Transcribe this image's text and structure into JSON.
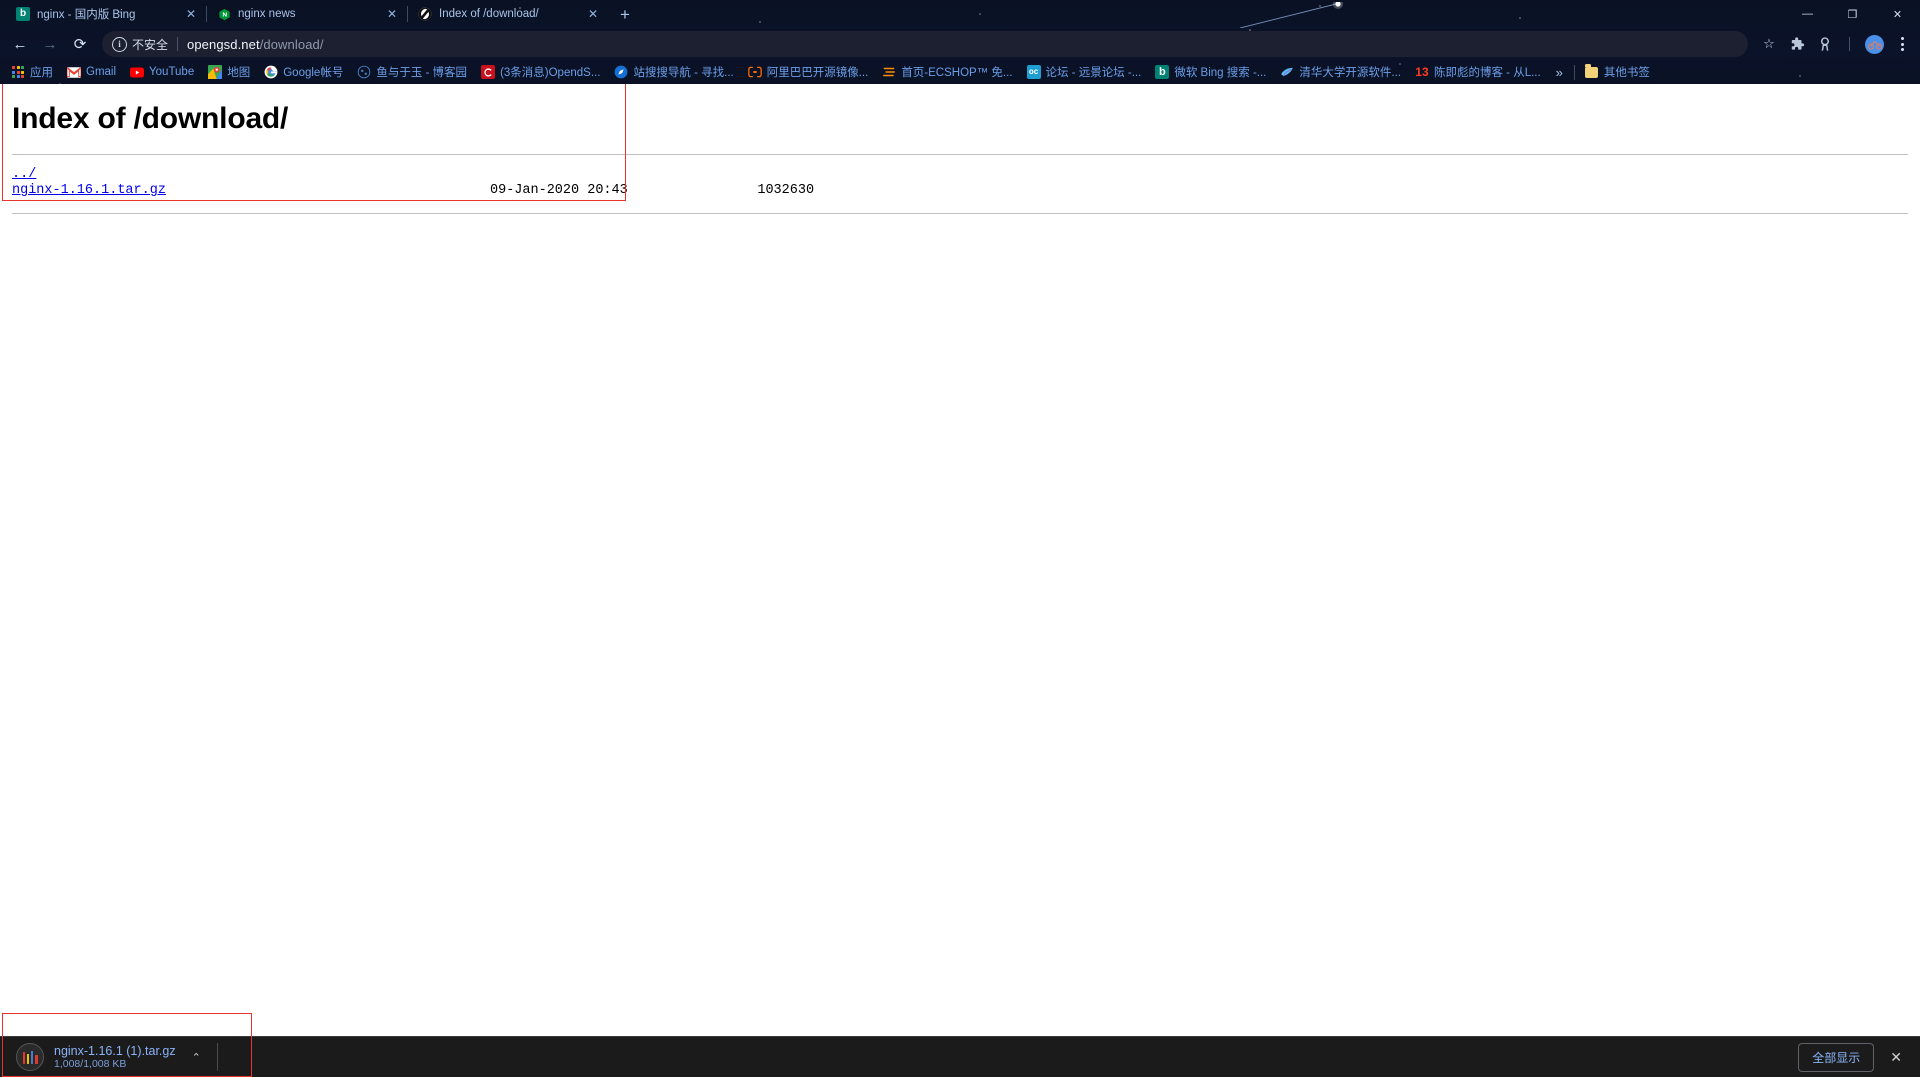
{
  "window": {
    "controls": {
      "minimize": "—",
      "maximize": "❐",
      "close": "✕"
    }
  },
  "tabs": [
    {
      "title": "nginx - 国内版 Bing",
      "favicon": "bing-icon",
      "close": "✕",
      "active": false
    },
    {
      "title": "nginx news",
      "favicon": "nginx-icon",
      "close": "✕",
      "active": false
    },
    {
      "title": "Index of /download/",
      "favicon": "nginx-globe-icon",
      "close": "✕",
      "active": true
    }
  ],
  "newtab_label": "+",
  "toolbar": {
    "back": "←",
    "forward": "→",
    "reload": "⟳",
    "security_label": "不安全",
    "security_icon": "i",
    "url_host": "opengsd.net",
    "url_path": "/download/",
    "bookmark_star": "☆",
    "extension_1": "puzzle-icon",
    "extension_2": "extension-icon",
    "profile": "avatar-bicycle",
    "menu": "kebab-menu"
  },
  "bookmarks": {
    "items": [
      {
        "label": "应用",
        "icon": "apps-grid-icon"
      },
      {
        "label": "Gmail",
        "icon": "gmail-icon"
      },
      {
        "label": "YouTube",
        "icon": "youtube-icon"
      },
      {
        "label": "地图",
        "icon": "maps-icon"
      },
      {
        "label": "Google帐号",
        "icon": "google-icon"
      },
      {
        "label": "鱼与于玉 - 博客园",
        "icon": "cnblogs-icon"
      },
      {
        "label": "(3条消息)OpendS...",
        "icon": "csdn-icon"
      },
      {
        "label": "站搜搜导航 - 寻找...",
        "icon": "compass-icon"
      },
      {
        "label": "阿里巴巴开源镜像...",
        "icon": "alibaba-icon"
      },
      {
        "label": "首页-ECSHOP™ 免...",
        "icon": "ecshop-icon"
      },
      {
        "label": "论坛 - 远景论坛 -...",
        "icon": "pcbeta-icon"
      },
      {
        "label": "微软 Bing 搜索 -...",
        "icon": "bing-icon"
      },
      {
        "label": "清华大学开源软件...",
        "icon": "tuna-icon"
      },
      {
        "label": "陈即彪的博客 - 从L...",
        "icon": "blog-13-icon"
      }
    ],
    "overflow_label": "»",
    "other_bookmarks_label": "其他书签",
    "other_bookmarks_icon": "folder-icon"
  },
  "page": {
    "heading": "Index of /download/",
    "listing": {
      "parent_link": "../",
      "rows": [
        {
          "name": "nginx-1.16.1.tar.gz",
          "date": "09-Jan-2020 20:43",
          "size": "1032630"
        }
      ]
    }
  },
  "download_shelf": {
    "file_name": "nginx-1.16.1 (1).tar.gz",
    "progress_text": "1,008/1,008 KB",
    "caret": "⌃",
    "show_all_label": "全部显示",
    "close_label": "✕"
  },
  "colors": {
    "link": "#0000ee",
    "visited": "#551a8b",
    "bookmark_text": "#6b9fe8",
    "accent_blue": "#8ab4f8",
    "annotation_red": "#e8342a"
  }
}
